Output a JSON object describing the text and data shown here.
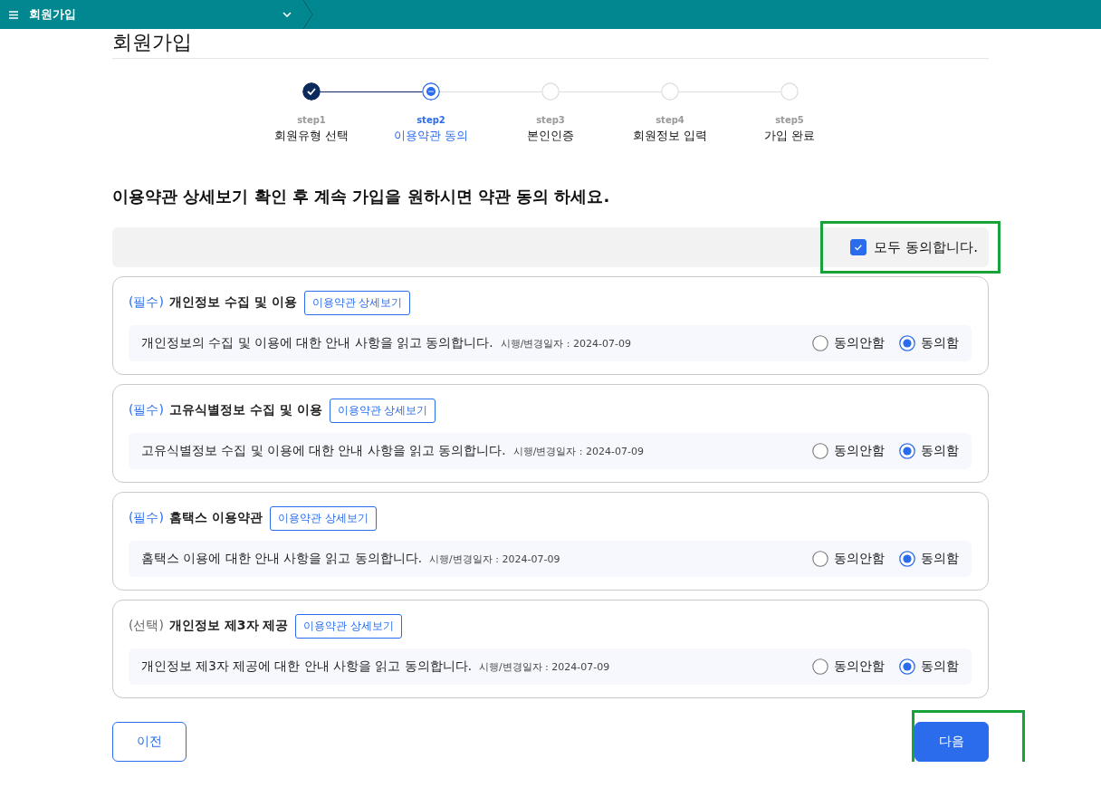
{
  "header": {
    "title": "회원가입"
  },
  "page_title": "회원가입",
  "steps": [
    {
      "step": "step1",
      "label": "회원유형 선택",
      "completed": true,
      "selected": false
    },
    {
      "step": "step2",
      "label": "이용약관 동의",
      "completed": false,
      "selected": true
    },
    {
      "step": "step3",
      "label": "본인인증",
      "completed": false,
      "selected": false
    },
    {
      "step": "step4",
      "label": "회원정보 입력",
      "completed": false,
      "selected": false
    },
    {
      "step": "step5",
      "label": "가입 완료",
      "completed": false,
      "selected": false
    }
  ],
  "instruction": "이용약관 상세보기 확인 후 계속 가입을 원하시면 약관 동의 하세요.",
  "agree_all": {
    "label": "모두 동의합니다.",
    "checked": true,
    "highlighted": true
  },
  "terms": [
    {
      "tag": "(필수)",
      "required": true,
      "title": "개인정보 수집 및 이용",
      "detail_button": "이용약관 상세보기",
      "description": "개인정보의 수집 및 이용에 대한 안내 사항을 읽고 동의합니다.",
      "effective_date": "시행/변경일자 : 2024-07-09",
      "options": [
        {
          "label": "동의안함",
          "selected": false
        },
        {
          "label": "동의함",
          "selected": true
        }
      ]
    },
    {
      "tag": "(필수)",
      "required": true,
      "title": "고유식별정보 수집 및 이용",
      "detail_button": "이용약관 상세보기",
      "description": "고유식별정보 수집 및 이용에 대한 안내 사항을 읽고 동의합니다.",
      "effective_date": "시행/변경일자 : 2024-07-09",
      "options": [
        {
          "label": "동의안함",
          "selected": false
        },
        {
          "label": "동의함",
          "selected": true
        }
      ]
    },
    {
      "tag": "(필수)",
      "required": true,
      "title": "홈택스 이용약관",
      "detail_button": "이용약관 상세보기",
      "description": "홈택스 이용에 대한 안내 사항을 읽고 동의합니다.",
      "effective_date": "시행/변경일자 : 2024-07-09",
      "options": [
        {
          "label": "동의안함",
          "selected": false
        },
        {
          "label": "동의함",
          "selected": true
        }
      ]
    },
    {
      "tag": "(선택)",
      "required": false,
      "title": "개인정보 제3자 제공",
      "detail_button": "이용약관 상세보기",
      "description": "개인정보 제3자 제공에 대한 안내 사항을 읽고 동의합니다.",
      "effective_date": "시행/변경일자 : 2024-07-09",
      "options": [
        {
          "label": "동의안함",
          "selected": false
        },
        {
          "label": "동의함",
          "selected": true
        }
      ]
    }
  ],
  "buttons": {
    "prev": {
      "label": "이전"
    },
    "next": {
      "label": "다음",
      "highlighted": true
    }
  }
}
